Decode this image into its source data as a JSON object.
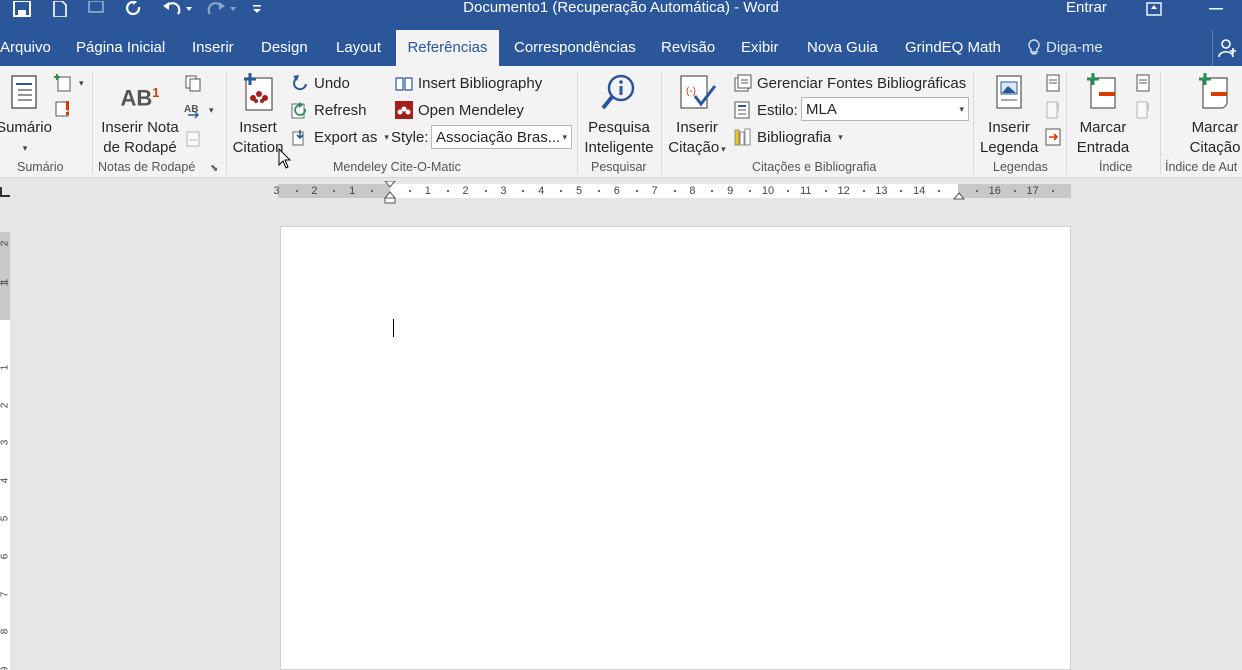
{
  "window": {
    "title": "Documento1 (Recuperação Automática)  -  Word",
    "signin": "Entrar"
  },
  "tabs": [
    {
      "label": "Arquivo"
    },
    {
      "label": "Página Inicial"
    },
    {
      "label": "Inserir"
    },
    {
      "label": "Design"
    },
    {
      "label": "Layout"
    },
    {
      "label": "Referências"
    },
    {
      "label": "Correspondências"
    },
    {
      "label": "Revisão"
    },
    {
      "label": "Exibir"
    },
    {
      "label": "Nova Guia"
    },
    {
      "label": "GrindEQ Math"
    },
    {
      "label": "Diga-me"
    }
  ],
  "active_tab": "Referências",
  "ribbon": {
    "sumario": {
      "label": "Sumário",
      "group": "Sumário"
    },
    "notas": {
      "label1": "Inserir Nota",
      "label2": "de Rodapé",
      "group": "Notas de Rodapé",
      "ab_label": "AB"
    },
    "mendeley": {
      "insert_citation1": "Insert",
      "insert_citation2": "Citation",
      "undo": "Undo",
      "refresh": "Refresh",
      "export": "Export as",
      "insert_bibliography": "Insert Bibliography",
      "open_mendeley": "Open Mendeley",
      "style_label": "Style:",
      "style_value": "Associação Bras...",
      "group": "Mendeley Cite-O-Matic"
    },
    "pesquisar": {
      "label1": "Pesquisa",
      "label2": "Inteligente",
      "group": "Pesquisar"
    },
    "citacoes": {
      "inserir1": "Inserir",
      "inserir2": "Citação",
      "gerenciar": "Gerenciar Fontes Bibliográficas",
      "estilo_label": "Estilo:",
      "estilo_value": "MLA",
      "bibliografia": "Bibliografia",
      "group": "Citações e Bibliografia"
    },
    "legendas": {
      "label1": "Inserir",
      "label2": "Legenda",
      "group": "Legendas"
    },
    "indice": {
      "label1": "Marcar",
      "label2": "Entrada",
      "group": "Índice"
    },
    "indice_aut": {
      "label1": "Marcar",
      "label2": "Citação",
      "group": "Índice de Aut"
    }
  },
  "ruler": {
    "numbers": [
      "3",
      "2",
      "1",
      "1",
      "2",
      "3",
      "4",
      "5",
      "6",
      "7",
      "8",
      "9",
      "10",
      "11",
      "12",
      "13",
      "14",
      "16",
      "17"
    ],
    "vnumbers": [
      "2",
      "1",
      "1",
      "1",
      "2",
      "3",
      "4",
      "5",
      "6",
      "7",
      "8",
      "9"
    ]
  },
  "colors": {
    "accent": "#2b579a",
    "mendeley_red": "#a51e1e"
  }
}
